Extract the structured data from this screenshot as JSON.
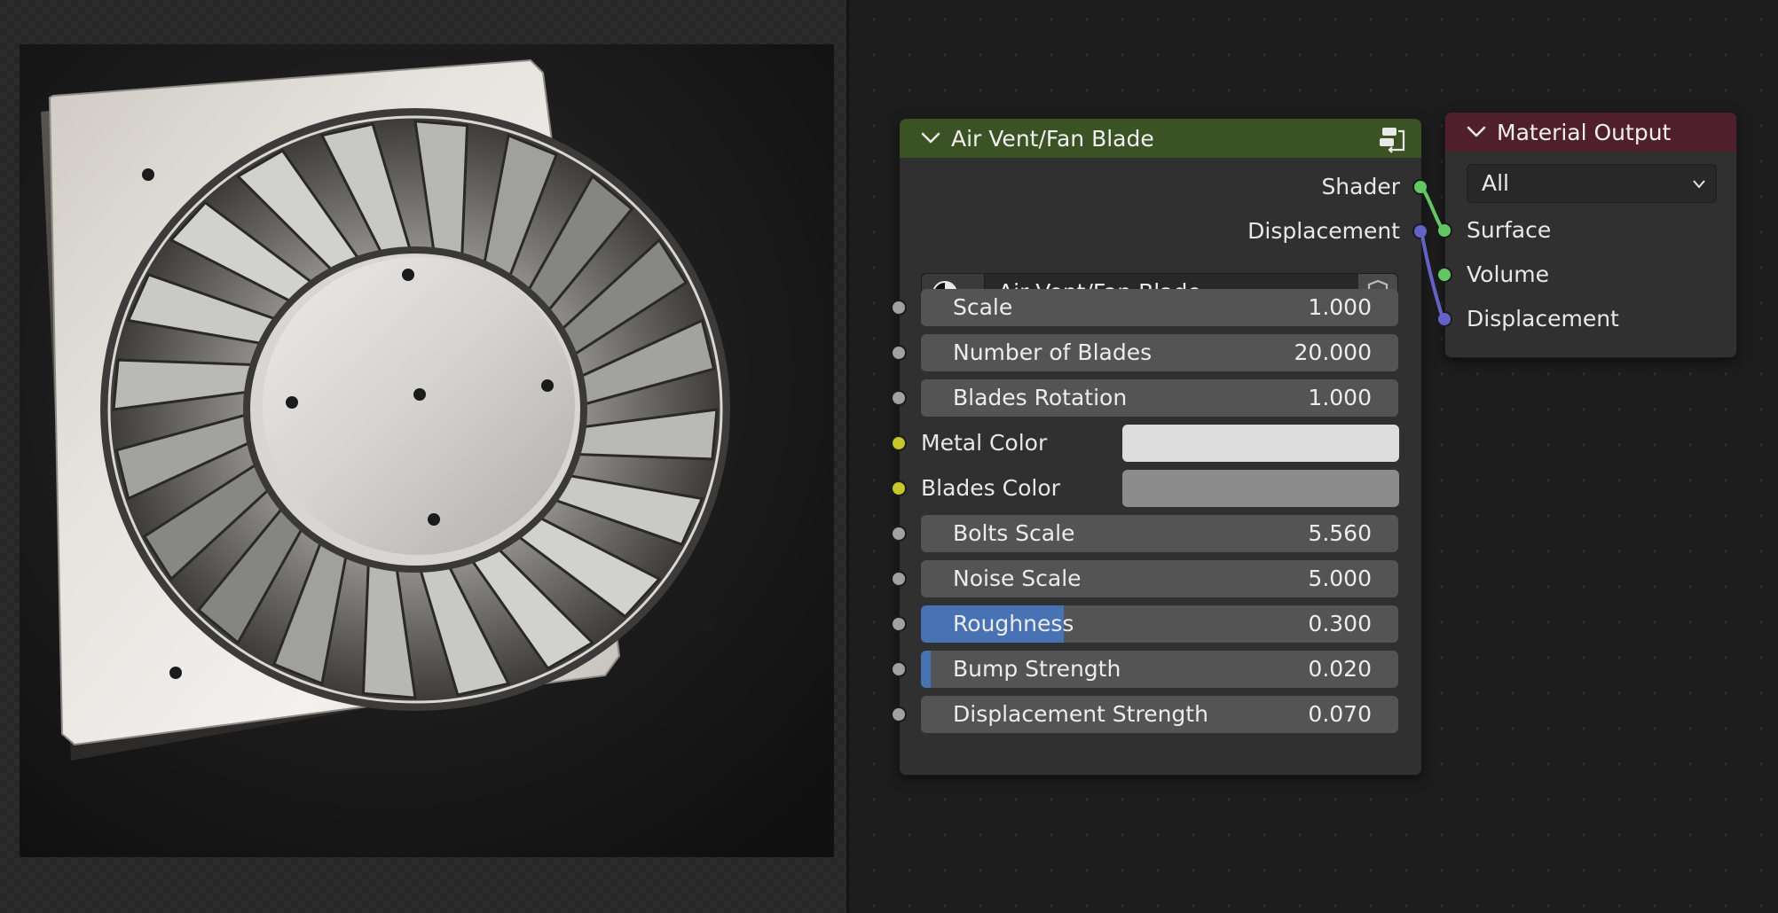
{
  "colors": {
    "group_header": "#3b5224",
    "output_header": "#4f1f2b",
    "node_body": "#303030",
    "field": "#545454",
    "accent_blue": "#4772b3",
    "socket_grey": "#a1a1a1",
    "socket_yellow": "#c7c729",
    "socket_green": "#63c763",
    "socket_purple": "#6363c7"
  },
  "group_node": {
    "title": "Air Vent/Fan Blade",
    "outputs": [
      "Shader",
      "Displacement"
    ],
    "datablock": {
      "name": "Air Vent/Fan Blade",
      "type_icon": "material-sphere-icon",
      "fake_user_icon": "shield-icon"
    },
    "inputs": [
      {
        "label": "Scale",
        "value": "1.000",
        "kind": "number",
        "socket": "grey"
      },
      {
        "label": "Number of Blades",
        "value": "20.000",
        "kind": "number",
        "socket": "grey"
      },
      {
        "label": "Blades Rotation",
        "value": "1.000",
        "kind": "number",
        "socket": "grey"
      },
      {
        "label": "Metal Color",
        "kind": "color",
        "color": "#dcdcdc",
        "socket": "yellow"
      },
      {
        "label": "Blades Color",
        "kind": "color",
        "color": "#8c8c8c",
        "socket": "yellow"
      },
      {
        "label": "Bolts Scale",
        "value": "5.560",
        "kind": "number",
        "socket": "grey"
      },
      {
        "label": "Noise Scale",
        "value": "5.000",
        "kind": "number",
        "socket": "grey"
      },
      {
        "label": "Roughness",
        "value": "0.300",
        "kind": "factor",
        "fraction": 0.3,
        "socket": "grey"
      },
      {
        "label": "Bump Strength",
        "value": "0.020",
        "kind": "factor",
        "fraction": 0.02,
        "socket": "grey"
      },
      {
        "label": "Displacement Strength",
        "value": "0.070",
        "kind": "number",
        "socket": "grey"
      }
    ]
  },
  "output_node": {
    "title": "Material Output",
    "target": "All",
    "inputs": [
      "Surface",
      "Volume",
      "Displacement"
    ]
  }
}
